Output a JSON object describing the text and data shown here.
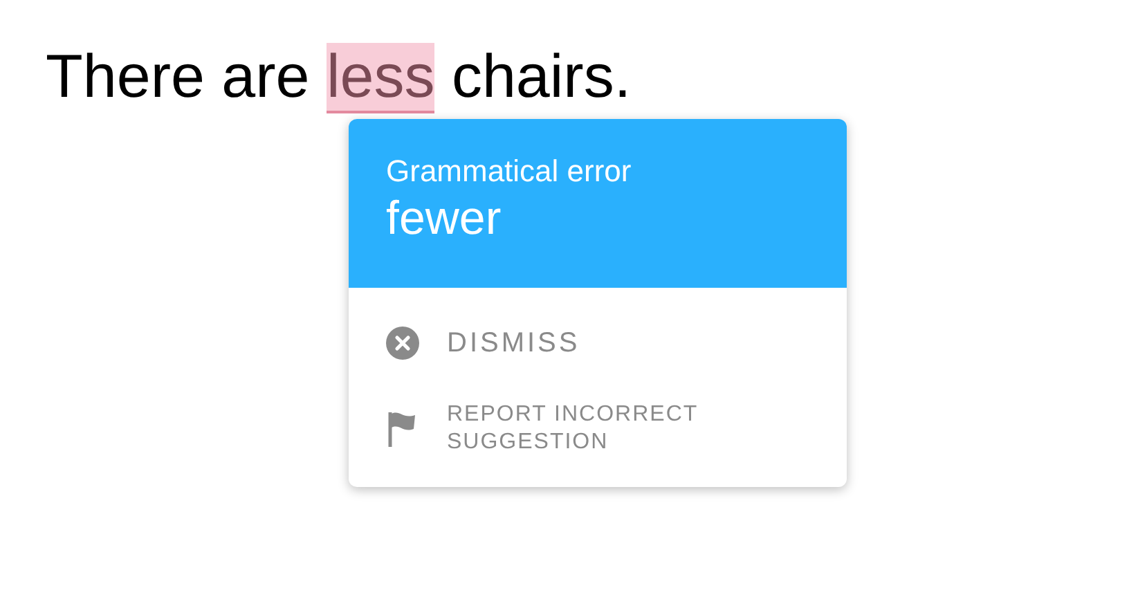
{
  "sentence": {
    "before": "There are ",
    "flagged": "less",
    "after": " chairs."
  },
  "popup": {
    "category": "Grammatical error",
    "suggestion": "fewer",
    "actions": [
      {
        "kind": "dismiss",
        "label": "DISMISS"
      },
      {
        "kind": "report",
        "label": "REPORT INCORRECT SUGGESTION"
      }
    ]
  }
}
